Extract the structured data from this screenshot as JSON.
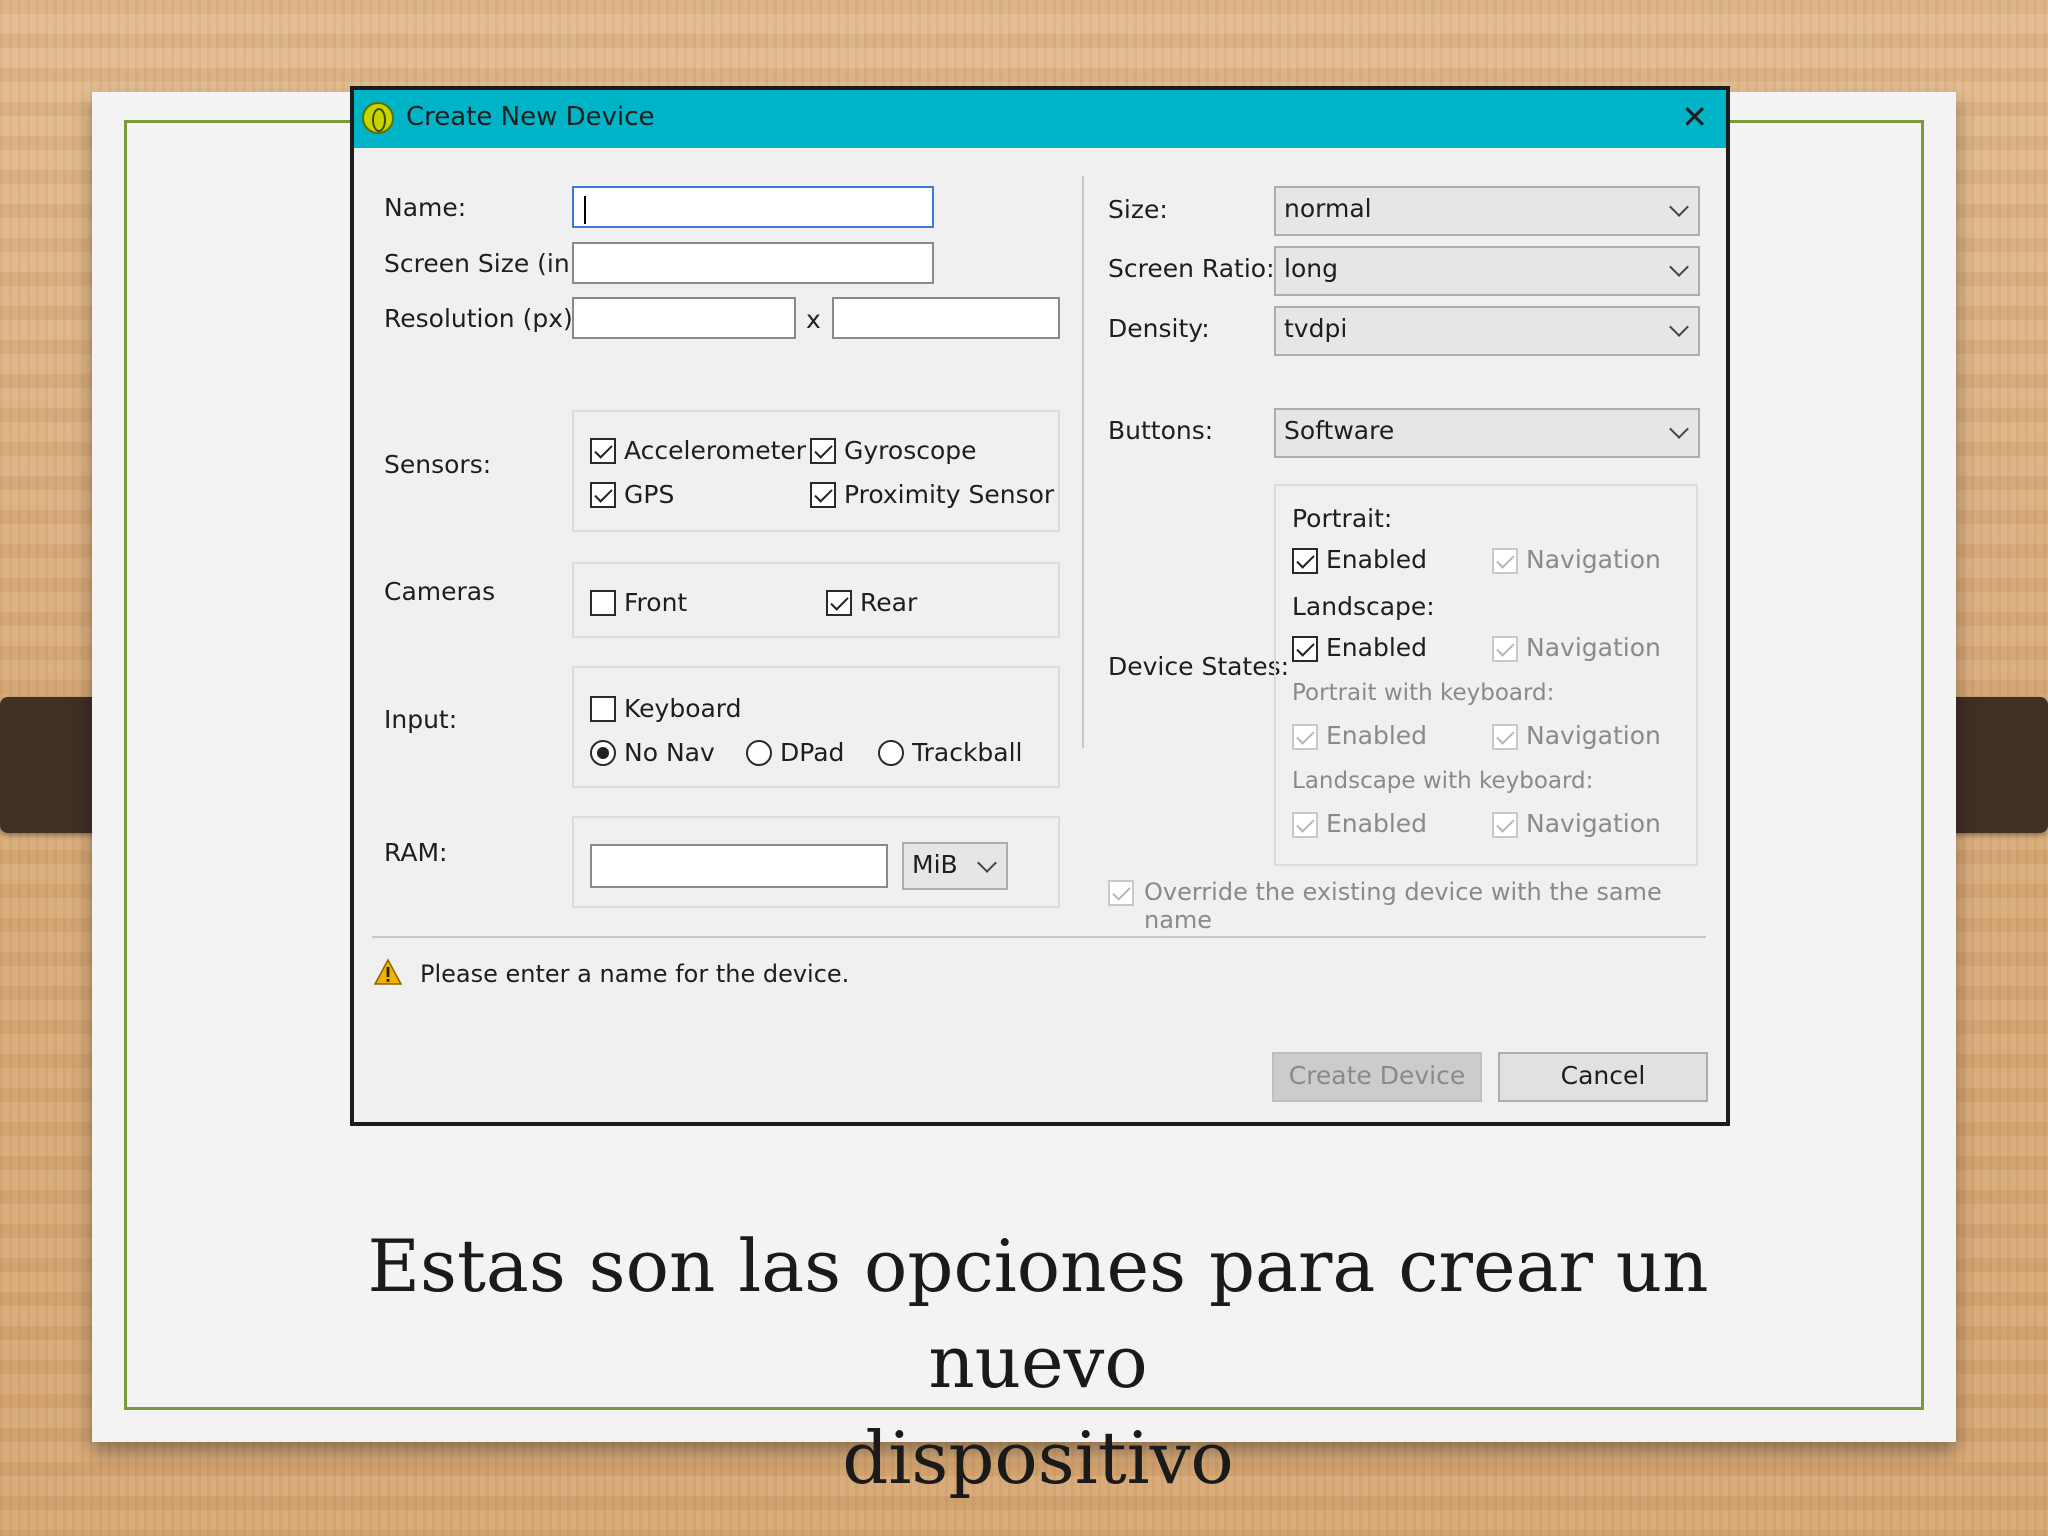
{
  "dialog": {
    "title": "Create New Device",
    "close_symbol": "✕",
    "name_label": "Name:",
    "screen_size_label": "Screen Size (in):",
    "resolution_label": "Resolution (px):",
    "resolution_x": "x",
    "sensors": {
      "label": "Sensors:",
      "accelerometer": "Accelerometer",
      "gyroscope": "Gyroscope",
      "gps": "GPS",
      "proximity": "Proximity Sensor"
    },
    "cameras": {
      "label": "Cameras",
      "front": "Front",
      "rear": "Rear"
    },
    "input": {
      "label": "Input:",
      "keyboard": "Keyboard",
      "no_nav": "No Nav",
      "dpad": "DPad",
      "trackball": "Trackball"
    },
    "ram": {
      "label": "RAM:",
      "unit": "MiB"
    },
    "size": {
      "label": "Size:",
      "value": "normal"
    },
    "screen_ratio": {
      "label": "Screen Ratio:",
      "value": "long"
    },
    "density": {
      "label": "Density:",
      "value": "tvdpi"
    },
    "buttons": {
      "label": "Buttons:",
      "value": "Software"
    },
    "device_states": {
      "label": "Device States:",
      "portrait": "Portrait:",
      "landscape": "Landscape:",
      "portrait_keyboard": "Portrait with keyboard:",
      "landscape_keyboard": "Landscape with keyboard:",
      "enabled": "Enabled",
      "navigation": "Navigation"
    },
    "override": "Override the existing device with the same name",
    "warning": "Please enter a name for the device.",
    "create_button": "Create Device",
    "cancel_button": "Cancel"
  },
  "slide": {
    "caption_line1": "Estas son las opciones para crear un nuevo",
    "caption_line2": "dispositivo"
  },
  "colors": {
    "titlebar": "#00b4c8",
    "frame_border": "#7b9a3c",
    "focus_border": "#3a7bd5"
  }
}
